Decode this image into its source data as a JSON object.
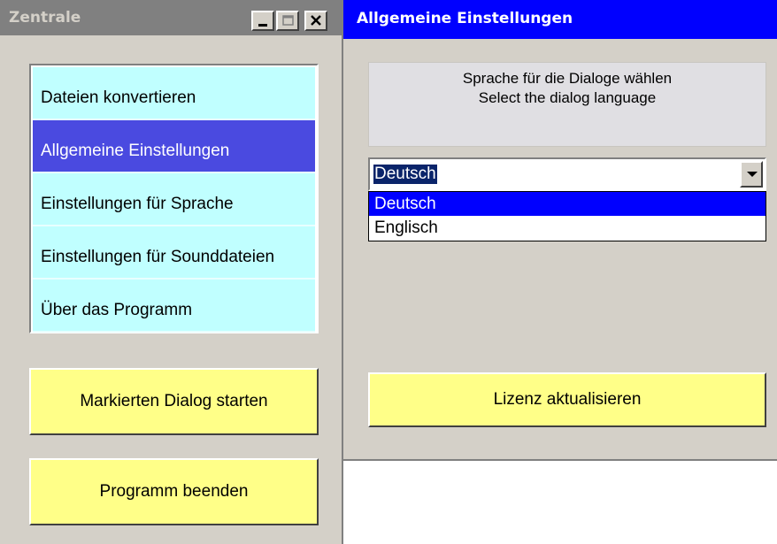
{
  "left_window": {
    "title": "Zentrale",
    "caption_buttons": {
      "minimize_icon": "minimize-icon",
      "maximize_icon": "maximize-icon",
      "close_icon": "close-icon"
    },
    "dialog_list": {
      "items": [
        {
          "label": "Dateien konvertieren",
          "selected": false
        },
        {
          "label": "Allgemeine Einstellungen",
          "selected": true
        },
        {
          "label": "Einstellungen für Sprache",
          "selected": false
        },
        {
          "label": "Einstellungen für Sounddateien",
          "selected": false
        },
        {
          "label": "Über das Programm",
          "selected": false
        }
      ]
    },
    "start_button": "Markierten Dialog starten",
    "quit_button": "Programm beenden"
  },
  "right_window": {
    "title": "Allgemeine Einstellungen",
    "language_prompt": {
      "line1": "Sprache für die Dialoge wählen",
      "line2": "Select the dialog language"
    },
    "language_combo": {
      "value": "Deutsch",
      "options": [
        {
          "label": "Deutsch",
          "selected": true
        },
        {
          "label": "Englisch",
          "selected": false
        }
      ]
    },
    "license_button": "Lizenz aktualisieren"
  },
  "colors": {
    "window_face": "#d4d0c8",
    "inactive_title": "#808080",
    "active_title": "#0000ff",
    "list_item_bg": "#c0ffff",
    "list_selected_bg": "#4a4ae0",
    "yellow_button": "#ffff88"
  }
}
